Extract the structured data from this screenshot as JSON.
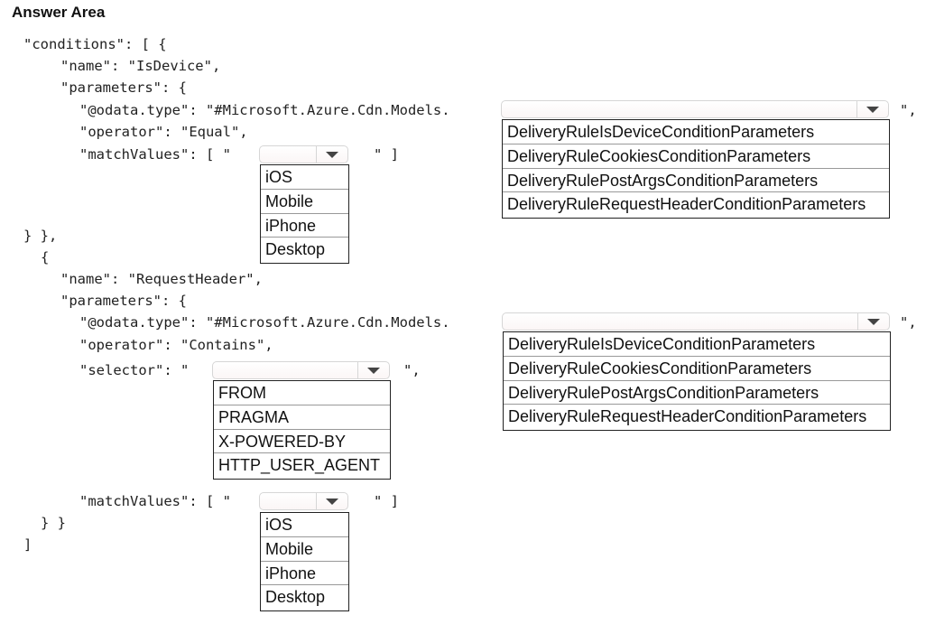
{
  "title": "Answer Area",
  "code": {
    "l_conditions": "\"conditions\": [ {",
    "l_name1": "\"name\": \"IsDevice\",",
    "l_params1": "\"parameters\": {",
    "l_odata1": "\"@odata.type\": \"#Microsoft.Azure.Cdn.Models.",
    "l_odata1_end": "\",",
    "l_operator1": "\"operator\": \"Equal\",",
    "l_match1": "\"matchValues\": [ \"",
    "l_match1_end": "\" ]",
    "l_close1": "} },",
    "l_open2": "{",
    "l_name2": "\"name\": \"RequestHeader\",",
    "l_params2": "\"parameters\": {",
    "l_odata2": "\"@odata.type\": \"#Microsoft.Azure.Cdn.Models.",
    "l_odata2_end": "\",",
    "l_operator2": "\"operator\": \"Contains\",",
    "l_selector": "\"selector\": \"",
    "l_selector_end": "\",",
    "l_match2": "\"matchValues\": [ \"",
    "l_match2_end": "\" ]",
    "l_close2": "} }",
    "l_close_arr": "]"
  },
  "dropdowns": {
    "odata1": {
      "selected": "",
      "options": [
        "DeliveryRuleIsDeviceConditionParameters",
        "DeliveryRuleCookiesConditionParameters",
        "DeliveryRulePostArgsConditionParameters",
        "DeliveryRuleRequestHeaderConditionParameters"
      ]
    },
    "match1": {
      "selected": "",
      "options": [
        "iOS",
        "Mobile",
        "iPhone",
        "Desktop"
      ]
    },
    "odata2": {
      "selected": "",
      "options": [
        "DeliveryRuleIsDeviceConditionParameters",
        "DeliveryRuleCookiesConditionParameters",
        "DeliveryRulePostArgsConditionParameters",
        "DeliveryRuleRequestHeaderConditionParameters"
      ]
    },
    "selector": {
      "selected": "",
      "options": [
        "FROM",
        "PRAGMA",
        "X-POWERED-BY",
        "HTTP_USER_AGENT"
      ]
    },
    "match2": {
      "selected": "",
      "options": [
        "iOS",
        "Mobile",
        "iPhone",
        "Desktop"
      ]
    }
  }
}
